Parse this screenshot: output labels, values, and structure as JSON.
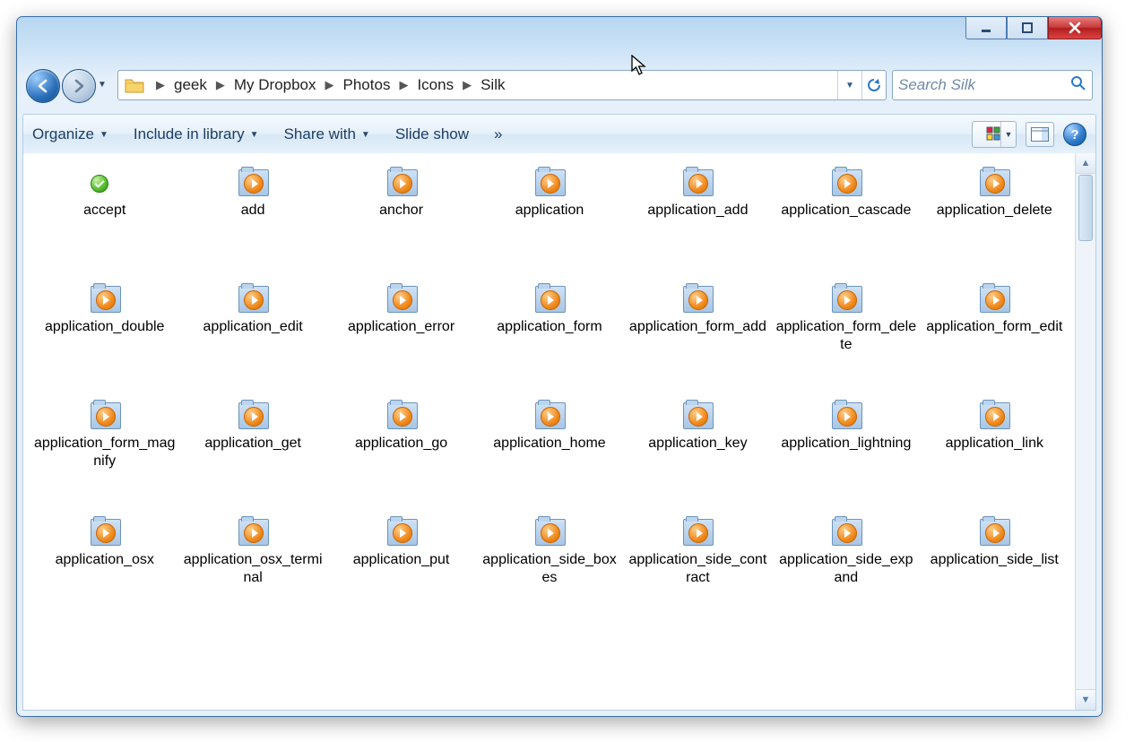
{
  "breadcrumb": {
    "segments": [
      "geek",
      "My Dropbox",
      "Photos",
      "Icons",
      "Silk"
    ]
  },
  "search": {
    "placeholder": "Search Silk"
  },
  "toolbar": {
    "organize": "Organize",
    "include": "Include in library",
    "share": "Share with",
    "slideshow": "Slide show",
    "overflow": "»"
  },
  "files": [
    {
      "name": "accept",
      "icon": "accept"
    },
    {
      "name": "add"
    },
    {
      "name": "anchor"
    },
    {
      "name": "application"
    },
    {
      "name": "application_add"
    },
    {
      "name": "application_cascade"
    },
    {
      "name": "application_delete"
    },
    {
      "name": "application_double"
    },
    {
      "name": "application_edit"
    },
    {
      "name": "application_error"
    },
    {
      "name": "application_form"
    },
    {
      "name": "application_form_add"
    },
    {
      "name": "application_form_delete"
    },
    {
      "name": "application_form_edit"
    },
    {
      "name": "application_form_magnify"
    },
    {
      "name": "application_get"
    },
    {
      "name": "application_go"
    },
    {
      "name": "application_home"
    },
    {
      "name": "application_key"
    },
    {
      "name": "application_lightning"
    },
    {
      "name": "application_link"
    },
    {
      "name": "application_osx"
    },
    {
      "name": "application_osx_terminal"
    },
    {
      "name": "application_put"
    },
    {
      "name": "application_side_boxes"
    },
    {
      "name": "application_side_contract"
    },
    {
      "name": "application_side_expand"
    },
    {
      "name": "application_side_list"
    }
  ]
}
